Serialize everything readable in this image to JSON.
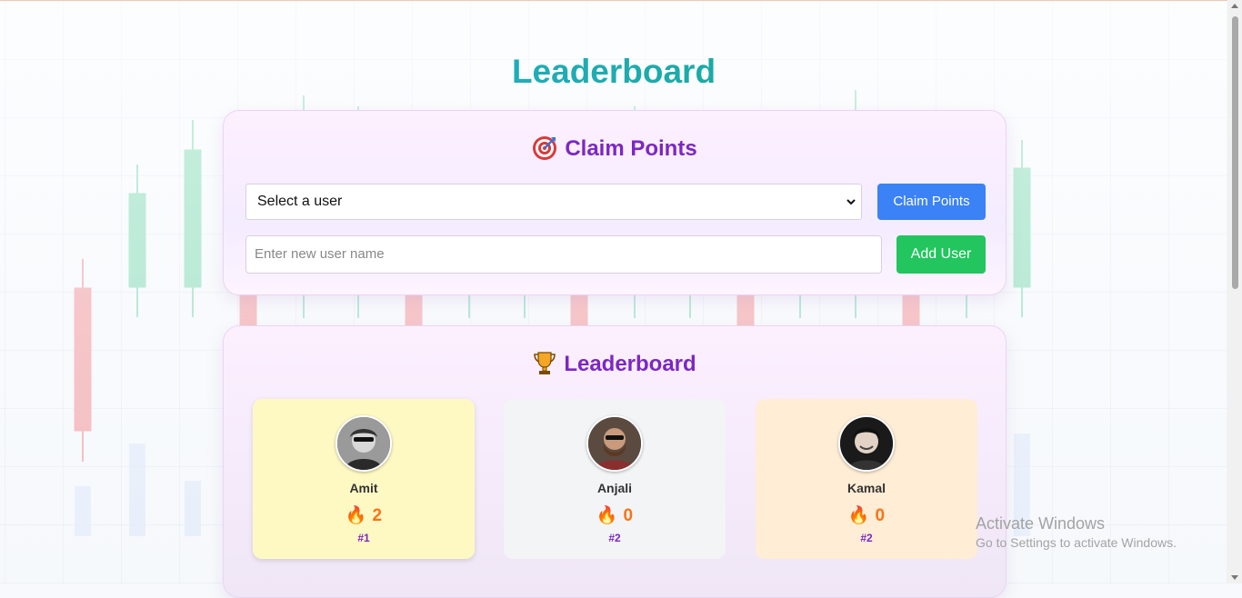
{
  "page": {
    "title": "Leaderboard"
  },
  "claim": {
    "title": "Claim Points",
    "select_value": "Select a user",
    "claim_label": "Claim Points",
    "name_placeholder": "Enter new user name",
    "add_label": "Add User"
  },
  "board": {
    "title": "Leaderboard",
    "players": [
      {
        "name": "Amit",
        "points": "2",
        "rank": "#1",
        "fire": "🔥"
      },
      {
        "name": "Anjali",
        "points": "0",
        "rank": "#2",
        "fire": "🔥"
      },
      {
        "name": "Kamal",
        "points": "0",
        "rank": "#2",
        "fire": "🔥"
      }
    ]
  },
  "watermark": {
    "line1": "Activate Windows",
    "line2": "Go to Settings to activate Windows."
  },
  "colors": {
    "title_gradient": [
      "#2bb5e8",
      "#10a277"
    ],
    "accent_purple": "#7d27c3",
    "claim_button": "#3b82f6",
    "add_button": "#22c55e",
    "score_orange": "#f97316",
    "rank1_card": "#fef9c3",
    "rank2_card": "#f3f4f6",
    "rank3_card": "#ffedd5"
  },
  "icons": {
    "claim": "target-icon",
    "board": "trophy-icon",
    "score": "fire-icon"
  }
}
